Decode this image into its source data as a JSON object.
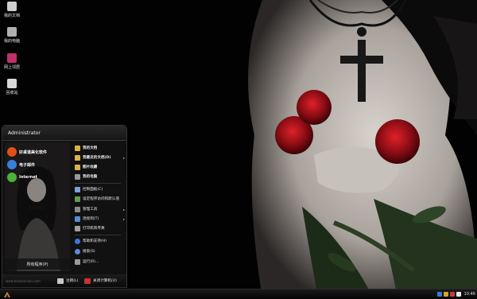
{
  "desktop_icons": [
    {
      "label": "我的文档",
      "icon": "my-documents-icon",
      "color": "#cfcfcf"
    },
    {
      "label": "我的电脑",
      "icon": "my-computer-icon",
      "color": "#b0b0b0"
    },
    {
      "label": "网上邻居",
      "icon": "network-places-icon",
      "color": "#c0306a"
    },
    {
      "label": "回收站",
      "icon": "recycle-bin-icon",
      "color": "#d8d8d8"
    }
  ],
  "start_menu": {
    "user": "Administrator",
    "pinned": [
      {
        "label": "好桌道美化软件",
        "icon": "beautify-app-icon",
        "color": "#e0501a"
      },
      {
        "label": "电子邮件",
        "icon": "email-icon",
        "color": "#3a7fd8"
      },
      {
        "label": "Internet",
        "icon": "internet-icon",
        "color": "#4ab33a"
      }
    ],
    "all_programs": "所有程序(P)",
    "right_items": [
      {
        "label": "我的文档",
        "icon": "folder-icon",
        "color": "#d9b04a",
        "bold": true
      },
      {
        "label": "我最近的文档(D)",
        "icon": "recent-docs-icon",
        "color": "#d9b04a",
        "bold": true,
        "arrow": "▸"
      },
      {
        "label": "图片收藏",
        "icon": "pictures-icon",
        "color": "#d9b04a",
        "bold": true
      },
      {
        "label": "我的电脑",
        "icon": "computer-icon",
        "color": "#999999",
        "bold": true
      },
      {
        "label": "控制面板(C)",
        "icon": "control-panel-icon",
        "color": "#7aa0d8"
      },
      {
        "label": "设定程序访问和默认值",
        "icon": "program-access-icon",
        "color": "#5aa050"
      },
      {
        "label": "管理工具",
        "icon": "admin-tools-icon",
        "color": "#8a8a8a",
        "arrow": "▸"
      },
      {
        "label": "连接到(T)",
        "icon": "connect-icon",
        "color": "#5a8ad8",
        "arrow": "▸"
      },
      {
        "label": "打印机和传真",
        "icon": "printer-icon",
        "color": "#a0a0a0"
      },
      {
        "label": "帮助和支持(H)",
        "icon": "help-icon",
        "color": "#3a78d8"
      },
      {
        "label": "搜索(S)",
        "icon": "search-icon",
        "color": "#5a8ad8"
      },
      {
        "label": "运行(R)...",
        "icon": "run-icon",
        "color": "#9a9a9a"
      }
    ],
    "logoff": "注销(L)",
    "shutdown": "关闭计算机(U)"
  },
  "watermark": "www.haodsunion.com",
  "taskbar": {
    "clock": "10:46",
    "tray_icons": [
      {
        "icon": "tray-icon-1",
        "color": "#3a78d8"
      },
      {
        "icon": "tray-icon-2",
        "color": "#d8a030"
      },
      {
        "icon": "tray-icon-3",
        "color": "#c04040"
      },
      {
        "icon": "tray-icon-4",
        "color": "#e8e8e8"
      }
    ]
  }
}
